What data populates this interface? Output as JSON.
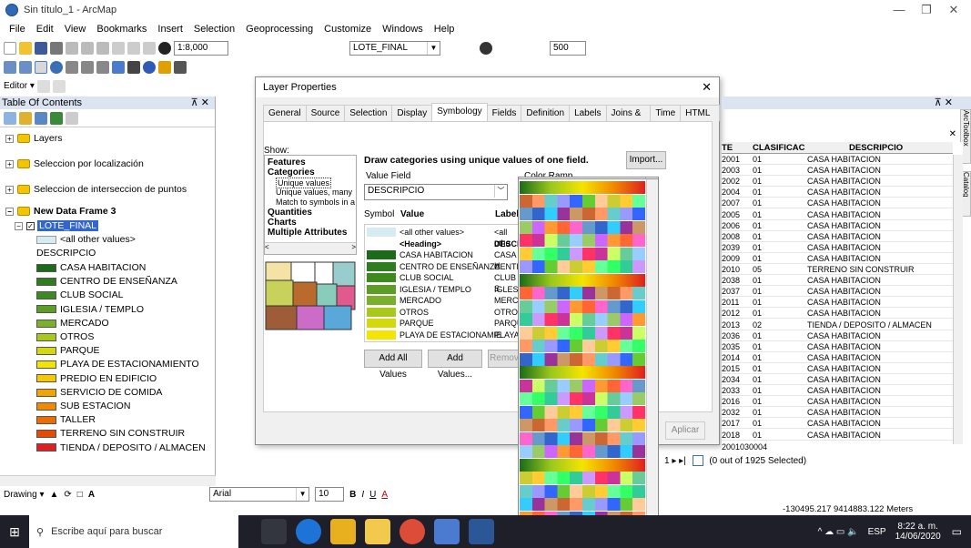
{
  "window": {
    "title": "Sin título_1 - ArcMap"
  },
  "menu": [
    "File",
    "Edit",
    "View",
    "Bookmarks",
    "Insert",
    "Selection",
    "Geoprocessing",
    "Customize",
    "Windows",
    "Help"
  ],
  "toolbar": {
    "scale": "1:8,000",
    "layer_combo": "LOTE_FINAL",
    "scale_val": "500"
  },
  "toc": {
    "title": "Table Of Contents",
    "layers_label": "Layers",
    "group1": "Seleccion por localización",
    "group2": "Seleccion de interseccion de puntos",
    "frame": "New Data Frame 3",
    "layer": "LOTE_FINAL",
    "all_other": "<all other values>",
    "field": "DESCRIPCIO",
    "classes": [
      {
        "label": "CASA HABITACION",
        "color": "#1a6b1a"
      },
      {
        "label": "CENTRO DE ENSEÑANZA",
        "color": "#2e7d1e"
      },
      {
        "label": "CLUB SOCIAL",
        "color": "#3d8b1f"
      },
      {
        "label": "IGLESIA / TEMPLO",
        "color": "#5c9e23"
      },
      {
        "label": "MERCADO",
        "color": "#7ab02a"
      },
      {
        "label": "OTROS",
        "color": "#a8c81c"
      },
      {
        "label": "PARQUE",
        "color": "#d4d80e"
      },
      {
        "label": "PLAYA DE ESTACIONAMIENTO",
        "color": "#f4e400"
      },
      {
        "label": "PREDIO EN EDIFICIO",
        "color": "#f5c800"
      },
      {
        "label": "SERVICIO DE COMIDA",
        "color": "#f3a400"
      },
      {
        "label": "SUB ESTACION",
        "color": "#f08a00"
      },
      {
        "label": "TALLER",
        "color": "#ec6c00"
      },
      {
        "label": "TERRENO SIN CONSTRUIR",
        "color": "#e84a00"
      },
      {
        "label": "TIENDA / DEPOSITO / ALMACEN",
        "color": "#e02020"
      }
    ]
  },
  "dialog": {
    "title": "Layer Properties",
    "tabs": [
      "General",
      "Source",
      "Selection",
      "Display",
      "Symbology",
      "Fields",
      "Definition Query",
      "Labels",
      "Joins & Relates",
      "Time",
      "HTML Popup"
    ],
    "show_label": "Show:",
    "show_items": [
      "Features",
      "Categories",
      "Unique values",
      "Unique values, many",
      "Match to symbols in a",
      "Quantities",
      "Charts",
      "Multiple Attributes"
    ],
    "heading": "Draw categories using unique values of one field.",
    "import_btn": "Import...",
    "value_field_label": "Value Field",
    "value_field": "DESCRIPCIO",
    "color_ramp_label": "Color Ramp",
    "col_symbol": "Symbol",
    "col_value": "Value",
    "col_label": "Label",
    "rows": [
      {
        "value": "<all other values>",
        "label": "<all othe"
      },
      {
        "value": "<Heading>",
        "label": "DESCI"
      },
      {
        "value": "CASA HABITACION",
        "label": "CASA H"
      },
      {
        "value": "CENTRO DE ENSEÑANZA",
        "label": "CENTR"
      },
      {
        "value": "CLUB SOCIAL",
        "label": "CLUB S"
      },
      {
        "value": "IGLESIA / TEMPLO",
        "label": "IGLESI"
      },
      {
        "value": "MERCADO",
        "label": "MERCA"
      },
      {
        "value": "OTROS",
        "label": "OTROS"
      },
      {
        "value": "PARQUE",
        "label": "PARQU"
      },
      {
        "value": "PLAYA DE ESTACIONAMIE",
        "label": "PLAYA"
      }
    ],
    "add_all": "Add All Values",
    "add_values": "Add Values...",
    "remove": "Remov",
    "apply": "Aplicar"
  },
  "table": {
    "col_te": "TE",
    "col_clasif": "CLASIFICAC",
    "col_desc": "DESCRIPCIO",
    "rows": [
      [
        "2001",
        "01",
        "CASA HABITACION"
      ],
      [
        "2003",
        "01",
        "CASA HABITACION"
      ],
      [
        "2002",
        "01",
        "CASA HABITACION"
      ],
      [
        "2004",
        "01",
        "CASA HABITACION"
      ],
      [
        "2007",
        "01",
        "CASA HABITACION"
      ],
      [
        "2005",
        "01",
        "CASA HABITACION"
      ],
      [
        "2006",
        "01",
        "CASA HABITACION"
      ],
      [
        "2008",
        "01",
        "CASA HABITACION"
      ],
      [
        "2039",
        "01",
        "CASA HABITACION"
      ],
      [
        "2009",
        "01",
        "CASA HABITACION"
      ],
      [
        "2010",
        "05",
        "TERRENO SIN CONSTRUIR"
      ],
      [
        "2038",
        "01",
        "CASA HABITACION"
      ],
      [
        "2037",
        "01",
        "CASA HABITACION"
      ],
      [
        "2011",
        "01",
        "CASA HABITACION"
      ],
      [
        "2012",
        "01",
        "CASA HABITACION"
      ],
      [
        "2013",
        "02",
        "TIENDA / DEPOSITO / ALMACEN"
      ],
      [
        "2036",
        "01",
        "CASA HABITACION"
      ],
      [
        "2035",
        "01",
        "CASA HABITACION"
      ],
      [
        "2014",
        "01",
        "CASA HABITACION"
      ],
      [
        "2015",
        "01",
        "CASA HABITACION"
      ],
      [
        "2034",
        "01",
        "CASA HABITACION"
      ],
      [
        "2033",
        "01",
        "CASA HABITACION"
      ],
      [
        "2016",
        "01",
        "CASA HABITACION"
      ],
      [
        "2032",
        "01",
        "CASA HABITACION"
      ],
      [
        "2017",
        "01",
        "CASA HABITACION"
      ],
      [
        "2018",
        "01",
        "CASA HABITACION"
      ]
    ],
    "last_row_prefix": "2001030004",
    "selected": "(0 out of 1925 Selected)",
    "side_tabs": [
      "ArcToolbox",
      "Catalog"
    ]
  },
  "drawing": {
    "label": "Drawing",
    "font": "Arial",
    "size": "10"
  },
  "status": {
    "coords": "-130495.217 9414883.122 Meters"
  },
  "taskbar": {
    "search": "Escribe aquí para buscar",
    "time": "8:22 a. m.",
    "date": "14/06/2020",
    "lang": "ESP"
  }
}
